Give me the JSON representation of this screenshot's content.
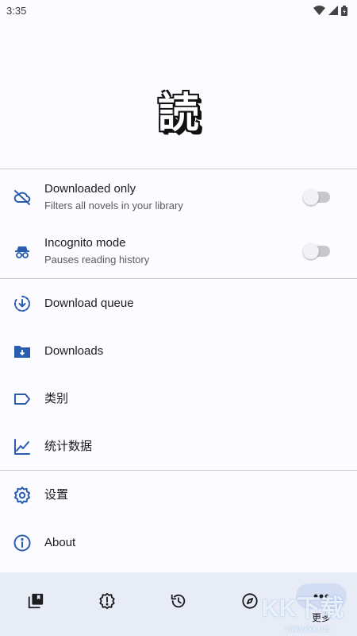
{
  "status_bar": {
    "time": "3:35",
    "icons": [
      "wifi-icon",
      "signal-icon",
      "battery-icon"
    ]
  },
  "logo": {
    "text": "読"
  },
  "toggles": [
    {
      "title": "Downloaded only",
      "subtitle": "Filters all novels in your library",
      "icon": "cloud-off-icon",
      "enabled": false
    },
    {
      "title": "Incognito mode",
      "subtitle": "Pauses reading history",
      "icon": "incognito-icon",
      "enabled": false
    }
  ],
  "menu": [
    {
      "label": "Download queue",
      "icon": "download-queue-icon"
    },
    {
      "label": "Downloads",
      "icon": "download-folder-icon"
    },
    {
      "label": "类别",
      "icon": "label-icon"
    },
    {
      "label": "统计数据",
      "icon": "chart-line-icon"
    }
  ],
  "settings_menu": [
    {
      "label": "设置",
      "icon": "gear-icon"
    },
    {
      "label": "About",
      "icon": "info-icon"
    }
  ],
  "bottom_nav": {
    "items": [
      "library-icon",
      "updates-icon",
      "history-icon",
      "browse-icon",
      "more-icon"
    ],
    "active_label": "更多"
  },
  "watermark": {
    "brand": "KK下载",
    "url": "www.kkx.net"
  },
  "colors": {
    "accent": "#2a5db0",
    "nav_bg": "#e7ecf7",
    "active_pill": "#d2dcf2"
  }
}
